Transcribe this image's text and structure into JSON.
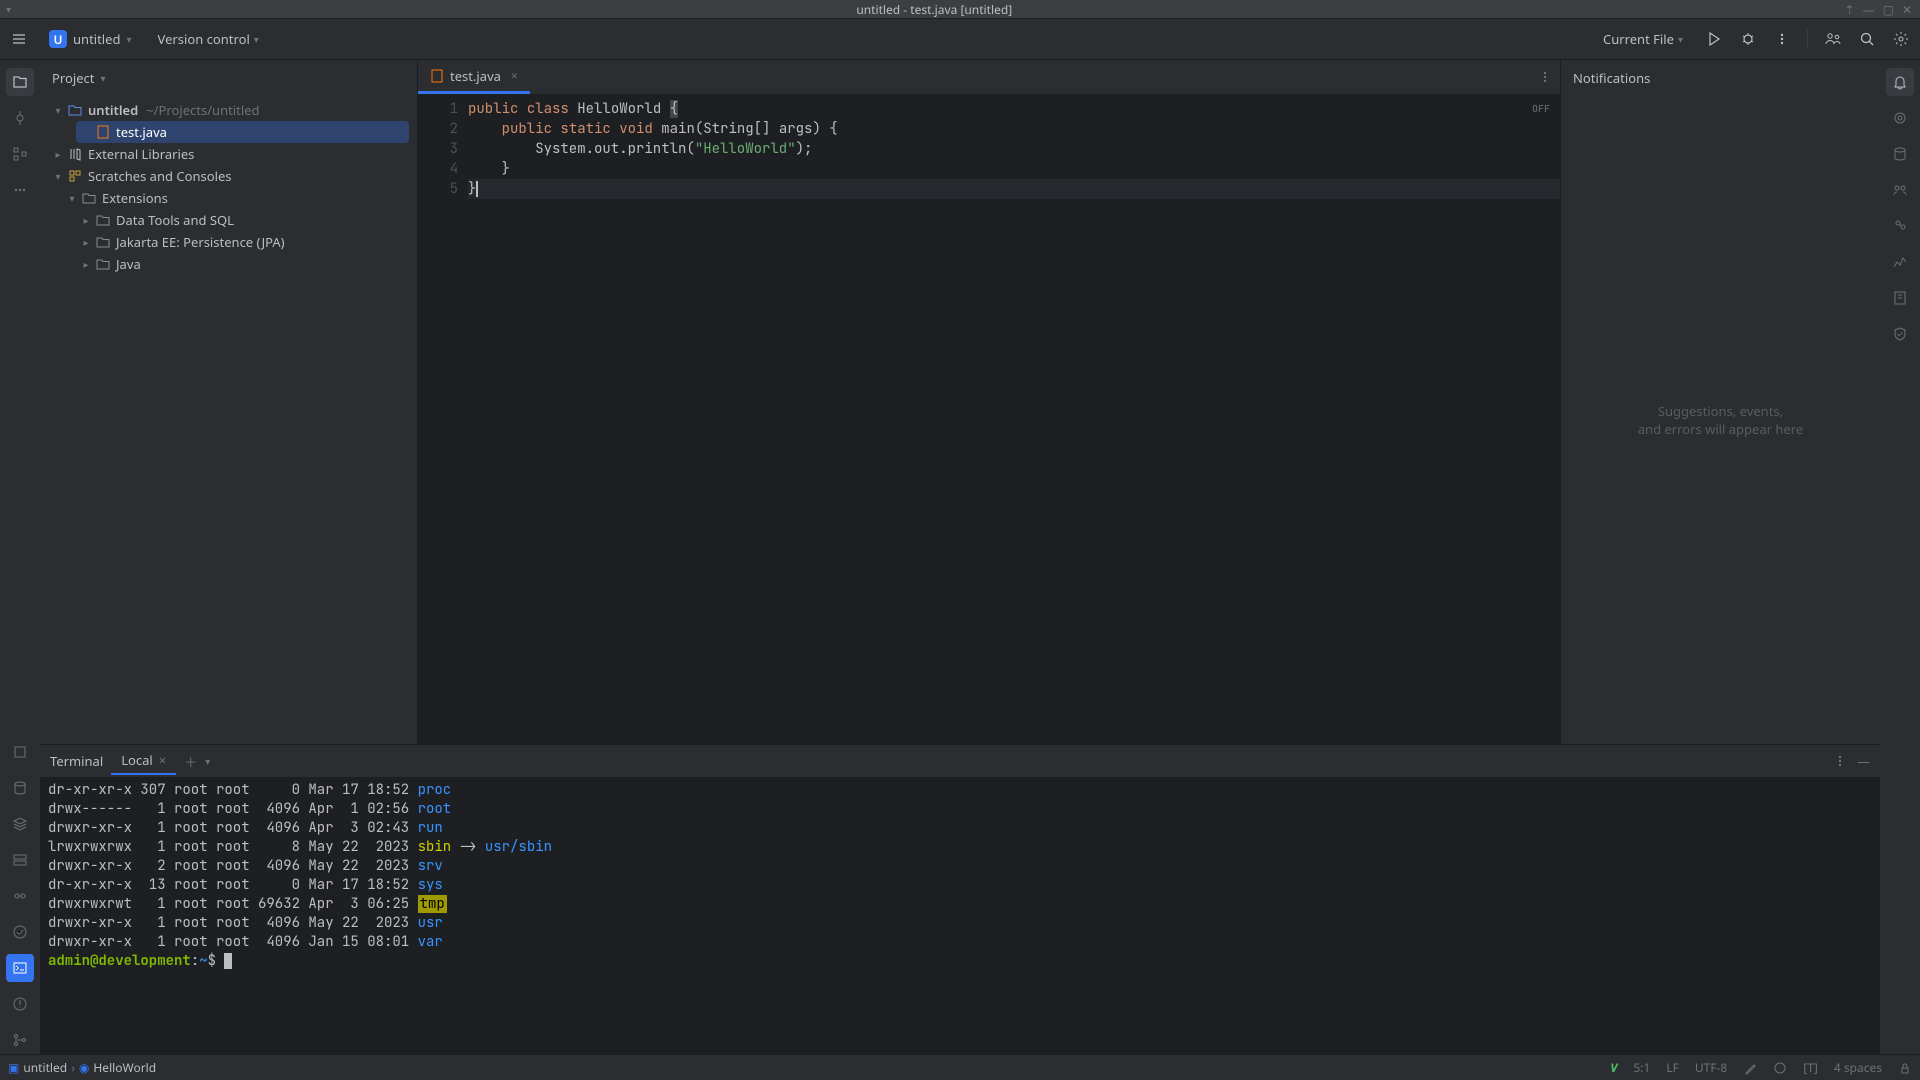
{
  "window": {
    "title": "untitled - test.java [untitled]"
  },
  "toolbar": {
    "project_name": "untitled",
    "project_initial": "U",
    "version_control": "Version control",
    "run_config": "Current File"
  },
  "project_tree": {
    "header": "Project",
    "root": {
      "name": "untitled",
      "path": "~/Projects/untitled"
    },
    "file": "test.java",
    "ext_libs": "External Libraries",
    "scratches": "Scratches and Consoles",
    "extensions": "Extensions",
    "ext_items": [
      "Data Tools and SQL",
      "Jakarta EE: Persistence (JPA)",
      "Java"
    ]
  },
  "editor": {
    "tab_name": "test.java",
    "inspections_badge": "OFF",
    "code_tokens": {
      "l1": {
        "kw1": "public",
        "kw2": "class",
        "cls": "HelloWorld",
        "br": "{"
      },
      "l2": {
        "kw1": "public",
        "kw2": "static",
        "kw3": "void",
        "fn": "main",
        "sig": "(String[] args) {"
      },
      "l3": {
        "obj": "System.out.println(",
        "str": "\"HelloWorld\"",
        "end": ");"
      },
      "l4": {
        "br": "}"
      },
      "l5": {
        "br": "}"
      }
    },
    "line_numbers": [
      "1",
      "2",
      "3",
      "4",
      "5"
    ]
  },
  "notifications": {
    "title": "Notifications",
    "empty1": "Suggestions, events,",
    "empty2": "and errors will appear here"
  },
  "terminal": {
    "title": "Terminal",
    "tab": "Local",
    "lines": [
      {
        "pre": "dr-xr-xr-x 307 root root     0 Mar 17 18:52 ",
        "name": "proc",
        "cls": "dir-blue"
      },
      {
        "pre": "drwx------   1 root root  4096 Apr  1 02:56 ",
        "name": "root",
        "cls": "dir-blue"
      },
      {
        "pre": "drwxr-xr-x   1 root root  4096 Apr  3 02:43 ",
        "name": "run",
        "cls": "dir-blue"
      },
      {
        "pre": "lrwxrwxrwx   1 root root     8 May 22  2023 ",
        "name": "sbin",
        "cls": "dir-cyan",
        "suffix": " -> ",
        "link": "usr/sbin"
      },
      {
        "pre": "drwxr-xr-x   2 root root  4096 May 22  2023 ",
        "name": "srv",
        "cls": "dir-blue"
      },
      {
        "pre": "dr-xr-xr-x  13 root root     0 Mar 17 18:52 ",
        "name": "sys",
        "cls": "dir-blue"
      },
      {
        "pre": "drwxrwxrwt   1 root root 69632 Apr  3 06:25 ",
        "name": "tmp",
        "cls": "tmp-dir"
      },
      {
        "pre": "drwxr-xr-x   1 root root  4096 May 22  2023 ",
        "name": "usr",
        "cls": "dir-blue"
      },
      {
        "pre": "drwxr-xr-x   1 root root  4096 Jan 15 08:01 ",
        "name": "var",
        "cls": "dir-blue"
      }
    ],
    "prompt_user": "admin@development",
    "prompt_sep": ":",
    "prompt_path": "~",
    "prompt_dollar": "$"
  },
  "status": {
    "crumb1": "untitled",
    "crumb2": "HelloWorld",
    "cursor": "5:1",
    "line_sep": "LF",
    "encoding": "UTF-8",
    "indent": "4 spaces",
    "tab_indicator": "[T]"
  }
}
